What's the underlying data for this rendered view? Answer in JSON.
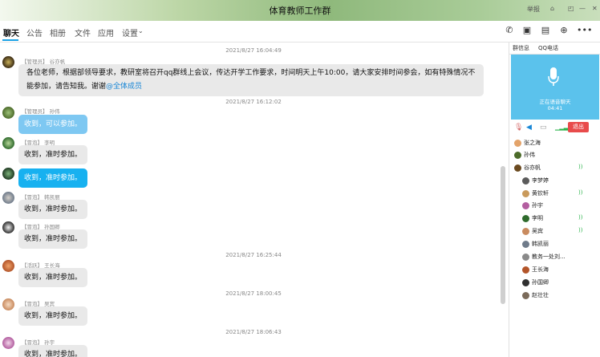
{
  "window": {
    "title": "体育教师工作群",
    "whiteboard_label": "举报"
  },
  "tabs": [
    "聊天",
    "公告",
    "相册",
    "文件",
    "应用",
    "设置"
  ],
  "messages": [
    {
      "time": "2021/8/27 16:04:49",
      "sender": "【管理员】 谷亦帆",
      "text": "各位老师，根据部领导要求，教研室将召开qq群线上会议，传达开学工作要求，时间明天上午10:00，请大家安排时间参会，如有特殊情况不能参加，请告知我。谢谢",
      "mention": "@全体成员"
    },
    {
      "time": "2021/8/27 16:12:02",
      "sender": "【管理员】 孙伟",
      "text": "收到，可以参加。"
    },
    {
      "sender": "【冒泡】 李明",
      "text": "收到，准时参加。"
    },
    {
      "text": "收到，准时参加。"
    },
    {
      "sender": "【冒泡】 韩凯丽",
      "text": "收到，准时参加。"
    },
    {
      "sender": "【冒泡】 孙国卿",
      "text": "收到，准时参加。"
    },
    {
      "time": "2021/8/27 16:25:44",
      "sender": "【活跃】 王长海",
      "text": "收到，准时参加。"
    },
    {
      "time": "2021/8/27 18:00:45",
      "sender": "【冒泡】 吴宾",
      "text": "收到，准时参加。"
    },
    {
      "time": "2021/8/27 18:06:43",
      "sender": "【冒泡】 孙宇",
      "text": "收到，准时参加。"
    }
  ],
  "right_panel": {
    "tabs": [
      "群信息",
      "QQ电话"
    ],
    "call_status": "正在语音聊天",
    "call_time": "04:41",
    "exit_label": "退出",
    "members": [
      {
        "name": "张之海",
        "speaking": false
      },
      {
        "name": "孙伟",
        "speaking": false
      },
      {
        "name": "谷亦帆",
        "speaking": true
      },
      {
        "name": "李梦婷",
        "speaking": false
      },
      {
        "name": "黄钦轩",
        "speaking": true
      },
      {
        "name": "孙宇",
        "speaking": false
      },
      {
        "name": "李明",
        "speaking": true
      },
      {
        "name": "吴宾",
        "speaking": true
      },
      {
        "name": "韩凯丽",
        "speaking": false
      },
      {
        "name": "教务一处刘...",
        "speaking": false
      },
      {
        "name": "王长海",
        "speaking": false
      },
      {
        "name": "孙国卿",
        "speaking": false
      },
      {
        "name": "赵壮壮",
        "speaking": false
      }
    ]
  },
  "colors": {
    "accent": "#1aa2e6",
    "bubble_blue": "#17b1f0",
    "call_bg": "#5bc2ec",
    "exit_red": "#e84b4b"
  }
}
